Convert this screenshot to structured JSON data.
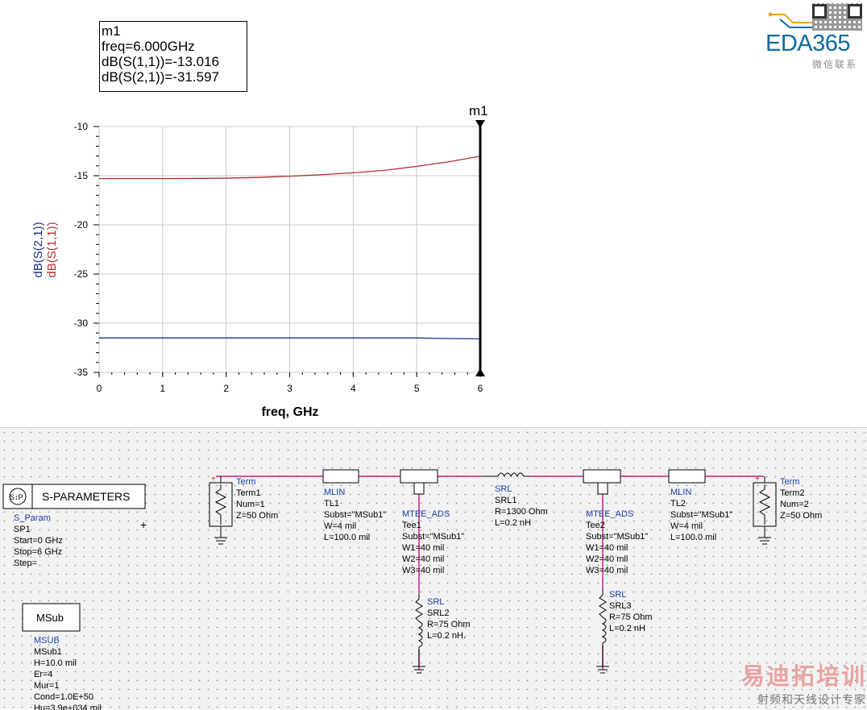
{
  "logo": {
    "brand": "EDA365",
    "sub": "微信联系"
  },
  "watermark": {
    "main": "易迪拓培训",
    "sub": "射频和天线设计专家"
  },
  "marker_box": {
    "lines": [
      "m1",
      "freq=6.000GHz",
      "dB(S(1,1))=-13.016",
      "dB(S(2,1))=-31.597"
    ]
  },
  "chart_data": {
    "type": "line",
    "xlabel": "freq, GHz",
    "ylabels": [
      "dB(S(2,1))",
      "dB(S(1,1))"
    ],
    "xlim": [
      0,
      6
    ],
    "ylim": [
      -35,
      -10
    ],
    "x_ticks": [
      0,
      1,
      2,
      3,
      4,
      5,
      6
    ],
    "y_ticks": [
      -10,
      -15,
      -20,
      -25,
      -30,
      -35
    ],
    "grid": true,
    "marker": {
      "name": "m1",
      "x": 6
    },
    "series": [
      {
        "name": "dB(S(1,1))",
        "color": "#b03030",
        "x": [
          0,
          0.5,
          1,
          1.5,
          2,
          2.5,
          3,
          3.5,
          4,
          4.5,
          5,
          5.5,
          6
        ],
        "values": [
          -15.3,
          -15.3,
          -15.3,
          -15.28,
          -15.25,
          -15.18,
          -15.05,
          -14.9,
          -14.7,
          -14.45,
          -14.05,
          -13.6,
          -13.016
        ]
      },
      {
        "name": "dB(S(2,1))",
        "color": "#1f2f8a",
        "x": [
          0,
          1,
          2,
          3,
          4,
          5,
          5.3,
          6
        ],
        "values": [
          -31.5,
          -31.5,
          -31.5,
          -31.5,
          -31.5,
          -31.5,
          -31.55,
          -31.597
        ]
      }
    ]
  },
  "schematic": {
    "sparam": {
      "title": "S-PARAMETERS",
      "lines": [
        "S_Param",
        "SP1",
        "Start=0 GHz",
        "Stop=6 GHz",
        "Step="
      ]
    },
    "msub": {
      "title": "MSub",
      "lines": [
        "MSUB",
        "MSub1",
        "H=10.0 mil",
        "Er=4",
        "Mur=1",
        "Cond=1.0E+50",
        "Hu=3.9e+034 mil"
      ]
    },
    "term1": {
      "lines": [
        "Term",
        "Term1",
        "Num=1",
        "Z=50 Ohm"
      ]
    },
    "term2": {
      "lines": [
        "Term",
        "Term2",
        "Num=2",
        "Z=50 Ohm"
      ]
    },
    "tl1": {
      "lines": [
        "MLIN",
        "TL1",
        "Subst=\"MSub1\"",
        "W=4 mil",
        "L=100.0 mil"
      ]
    },
    "tl2": {
      "lines": [
        "MLIN",
        "TL2",
        "Subst=\"MSub1\"",
        "W=4 mil",
        "L=100.0 mil"
      ]
    },
    "tee1": {
      "lines": [
        "MTEE_ADS",
        "Tee1",
        "Subst=\"MSub1\"",
        "W1=40 mil",
        "W2=40 mil",
        "W3=40 mil"
      ]
    },
    "tee2": {
      "lines": [
        "MTEE_ADS",
        "Tee2",
        "Subst=\"MSub1\"",
        "W1=40 mil",
        "W2=40 mil",
        "W3=40 mil"
      ]
    },
    "srl1": {
      "lines": [
        "SRL",
        "SRL1",
        "R=1300 Ohm",
        "L=0.2 nH"
      ]
    },
    "srl2": {
      "lines": [
        "SRL",
        "SRL2",
        "R=75 Ohm",
        "L=0.2 nH."
      ]
    },
    "srl3": {
      "lines": [
        "SRL",
        "SRL3",
        "R=75 Ohm",
        "L=0.2 nH"
      ]
    },
    "plus": "+"
  }
}
